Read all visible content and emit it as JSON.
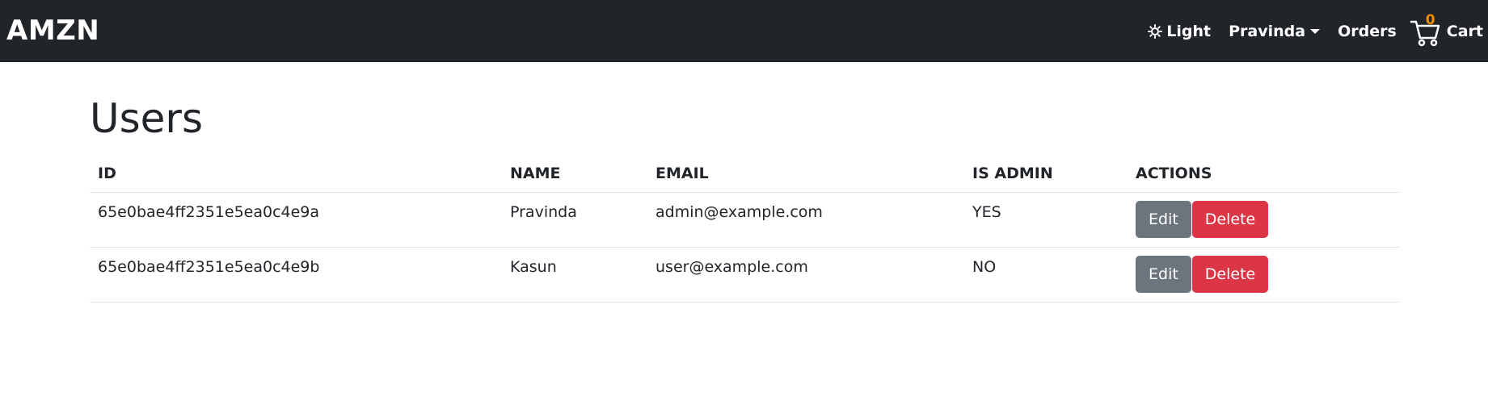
{
  "navbar": {
    "brand": "AMZN",
    "theme_label": "Light",
    "user_name": "Pravinda",
    "orders_label": "Orders",
    "cart_label": "Cart",
    "cart_count": "0",
    "badge_color": "#f08c00",
    "bg_color": "#212529"
  },
  "page": {
    "title": "Users"
  },
  "table": {
    "headers": {
      "id": "ID",
      "name": "NAME",
      "email": "EMAIL",
      "is_admin": "IS ADMIN",
      "actions": "ACTIONS"
    },
    "rows": [
      {
        "id": "65e0bae4ff2351e5ea0c4e9a",
        "name": "Pravinda",
        "email": "admin@example.com",
        "is_admin": "YES",
        "edit_label": "Edit",
        "delete_label": "Delete"
      },
      {
        "id": "65e0bae4ff2351e5ea0c4e9b",
        "name": "Kasun",
        "email": "user@example.com",
        "is_admin": "NO",
        "edit_label": "Edit",
        "delete_label": "Delete"
      }
    ]
  },
  "colors": {
    "edit_button": "#6c757d",
    "delete_button": "#dc3545"
  },
  "icons": {
    "theme": "sun-icon",
    "user_menu": "caret-down-icon",
    "cart": "cart-icon"
  }
}
